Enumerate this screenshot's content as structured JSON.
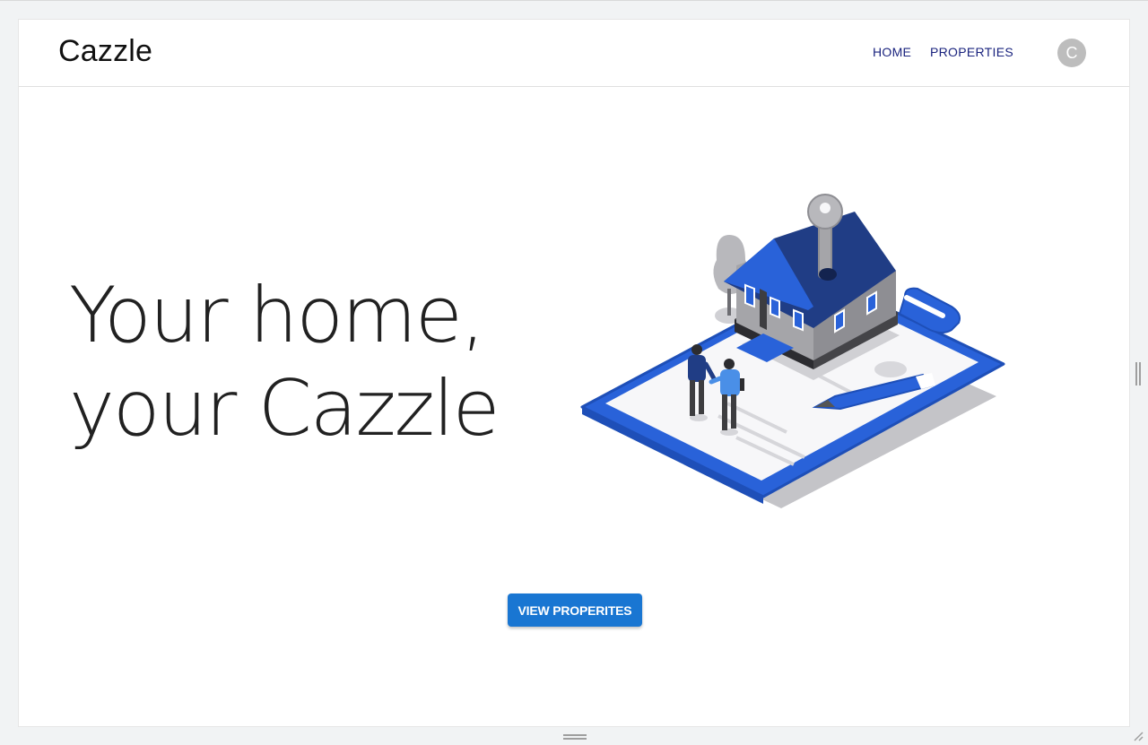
{
  "app": {
    "logo": "Cazzle"
  },
  "nav": {
    "home_label": "HOME",
    "properties_label": "PROPERTIES",
    "avatar_initial": "C"
  },
  "hero": {
    "line1": "Your home,",
    "line2": "your Cazzle",
    "cta_label": "VIEW PROPERITES"
  },
  "colors": {
    "primary": "#1976d2",
    "nav_text": "#1a237e",
    "illustration_blue": "#2962d9",
    "illustration_dark": "#203d85",
    "avatar_bg": "#bdbdbd"
  },
  "icons": {
    "illustration": "house-key-handshake-illustration",
    "resize_bottom": "drag-handle-icon",
    "resize_right": "drag-handle-icon",
    "resize_corner": "resize-corner-icon"
  }
}
